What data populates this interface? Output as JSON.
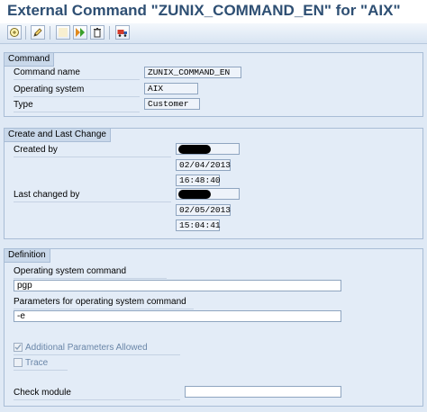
{
  "window": {
    "title": "External Command \"ZUNIX_COMMAND_EN\" for \"AIX\""
  },
  "toolbar": {
    "buttons": [
      {
        "icon": "display-change-icon",
        "label": ""
      },
      {
        "icon": "pencil-icon",
        "label": ""
      },
      {
        "icon": "blank-icon",
        "label": ""
      },
      {
        "icon": "execute-icon",
        "label": ""
      },
      {
        "icon": "delete-icon",
        "label": ""
      },
      {
        "icon": "transport-truck-icon",
        "label": ""
      }
    ]
  },
  "command_group": {
    "header": "Command",
    "command_name_label": "Command name",
    "command_name_value": "ZUNIX_COMMAND_EN",
    "os_label": "Operating system",
    "os_value": "AIX",
    "type_label": "Type",
    "type_value": "Customer"
  },
  "change_group": {
    "header": "Create and Last Change",
    "created_by_label": "Created by",
    "created_date": "02/04/2013",
    "created_time": "16:48:40",
    "changed_by_label": "Last changed by",
    "changed_date": "02/05/2013",
    "changed_time": "15:04:41"
  },
  "definition_group": {
    "header": "Definition",
    "os_command_label": "Operating system command",
    "os_command_value": "pgp",
    "parameters_label": "Parameters for operating system command",
    "parameters_value": "-e",
    "additional_params_label": "Additional Parameters Allowed",
    "additional_params_checked": true,
    "trace_label": "Trace",
    "trace_checked": false,
    "check_module_label": "Check module",
    "check_module_value": ""
  },
  "colors": {
    "title_text": "#2e4f73",
    "background": "#dfe9f5",
    "group_header": "#c9d8ea",
    "field_border": "#8fa5c0"
  }
}
